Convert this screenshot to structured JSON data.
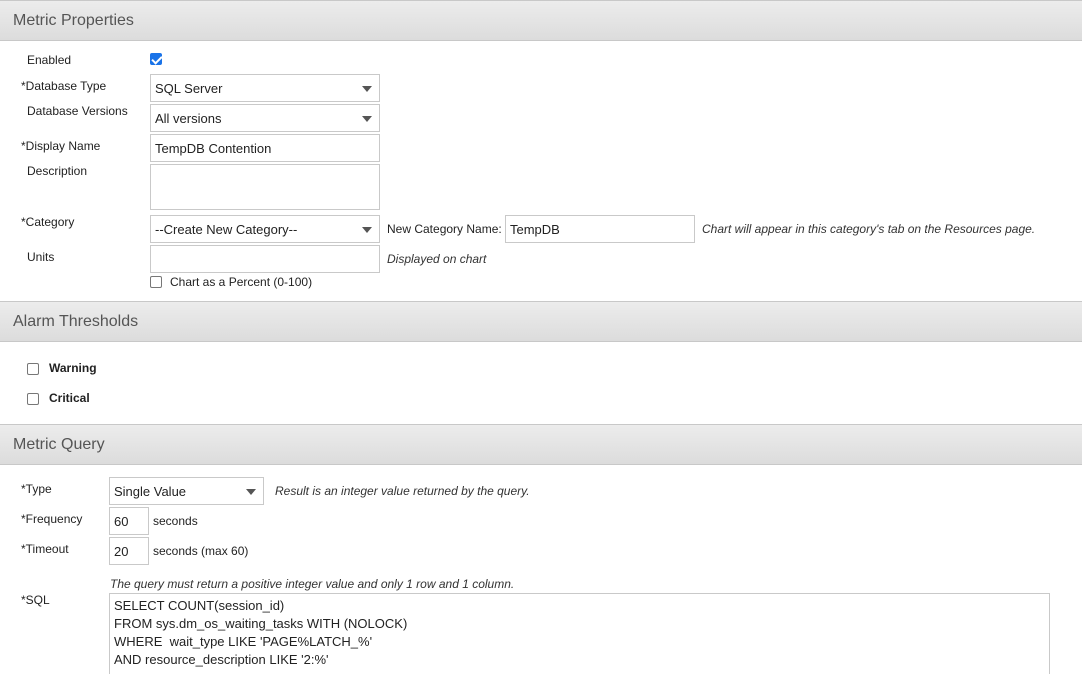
{
  "sections": {
    "metric_properties": "Metric Properties",
    "alarm_thresholds": "Alarm Thresholds",
    "metric_query": "Metric Query"
  },
  "props": {
    "enabled_label": "Enabled",
    "enabled_checked": true,
    "db_type_label": "*Database Type",
    "db_type_value": "SQL Server",
    "db_versions_label": "Database Versions",
    "db_versions_value": "All versions",
    "display_name_label": "*Display Name",
    "display_name_value": "TempDB Contention",
    "description_label": "Description",
    "description_value": "",
    "category_label": "*Category",
    "category_value": "--Create New Category--",
    "new_category_label": "New Category Name:",
    "new_category_value": "TempDB",
    "category_hint": "Chart will appear in this category's tab on the Resources page.",
    "units_label": "Units",
    "units_value": "",
    "units_hint": "Displayed on chart",
    "percent_label": "Chart as a Percent (0-100)",
    "percent_checked": false
  },
  "alarms": {
    "warning_label": "Warning",
    "critical_label": "Critical"
  },
  "query": {
    "type_label": "*Type",
    "type_value": "Single Value",
    "type_hint": "Result is an integer value returned by the query.",
    "frequency_label": "*Frequency",
    "frequency_value": "60",
    "frequency_unit": "seconds",
    "timeout_label": "*Timeout",
    "timeout_value": "20",
    "timeout_unit": "seconds (max 60)",
    "sql_hint": "The query must return a positive integer value and only 1 row and 1 column.",
    "sql_label": "*SQL",
    "sql_lines": [
      "SELECT COUNT(session_id)",
      "FROM sys.dm_os_waiting_tasks WITH (NOLOCK)",
      "WHERE  wait_type LIKE 'PAGE%LATCH_%'",
      "AND resource_description LIKE '2:%'"
    ]
  },
  "colors": {
    "checkbox_accent": "#1a73e8",
    "header_bg": "#e3e3e3"
  }
}
